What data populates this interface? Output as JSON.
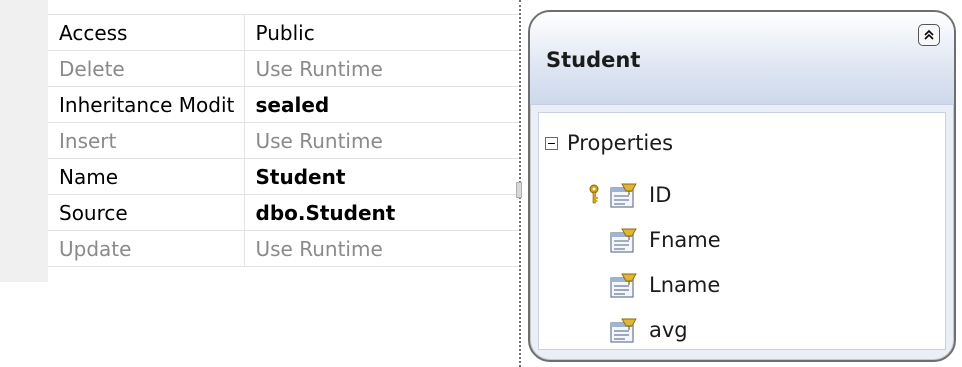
{
  "property_grid": {
    "rows": [
      {
        "name": "Access",
        "value": "Public",
        "state": "normal",
        "bold": false
      },
      {
        "name": "Delete",
        "value": "Use Runtime",
        "state": "disabled",
        "bold": false
      },
      {
        "name": "Inheritance Modit",
        "value": "sealed",
        "state": "normal",
        "bold": true
      },
      {
        "name": "Insert",
        "value": "Use Runtime",
        "state": "disabled",
        "bold": false
      },
      {
        "name": "Name",
        "value": "Student",
        "state": "normal",
        "bold": true
      },
      {
        "name": "Source",
        "value": "dbo.Student",
        "state": "normal",
        "bold": true
      },
      {
        "name": "Update",
        "value": "Use Runtime",
        "state": "disabled",
        "bold": false
      }
    ]
  },
  "entity": {
    "title": "Student",
    "section_label": "Properties",
    "properties": [
      {
        "name": "ID",
        "is_key": true
      },
      {
        "name": "Fname",
        "is_key": false
      },
      {
        "name": "Lname",
        "is_key": false
      },
      {
        "name": "avg",
        "is_key": false
      }
    ]
  },
  "icons": {
    "collapse": "double-chevron-up-icon",
    "key": "key-icon",
    "property": "property-icon",
    "section_toggle": "minus-box-icon"
  },
  "colors": {
    "disabled_text": "#8a8a8a",
    "header_gradient_end": "#cdd8ea",
    "key_gold": "#d8a21a"
  }
}
